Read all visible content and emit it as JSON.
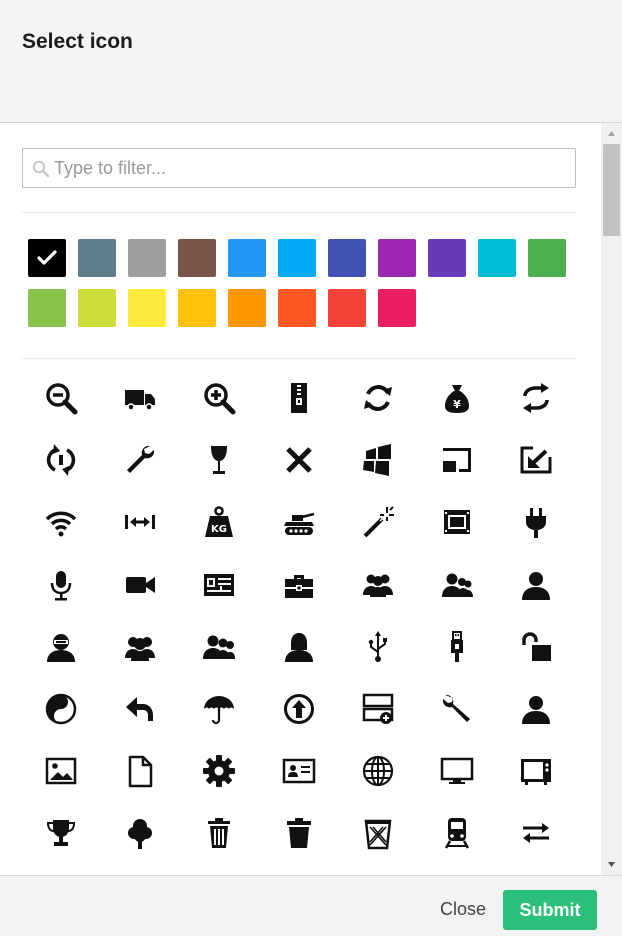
{
  "dialog": {
    "title": "Select icon"
  },
  "filter": {
    "placeholder": "Type to filter...",
    "value": ""
  },
  "colors": {
    "selected_index": 0,
    "swatches": [
      "#000000",
      "#607d8b",
      "#9e9e9e",
      "#795548",
      "#2196f3",
      "#03a9f4",
      "#3f51b5",
      "#9c27b0",
      "#673ab7",
      "#00bcd4",
      "#4caf50",
      "#8bc34a",
      "#cddc39",
      "#ffeb3b",
      "#ffc107",
      "#ff9800",
      "#ff5722",
      "#f44336",
      "#e91e63"
    ]
  },
  "icons": [
    "zoom-out-icon",
    "truck-icon",
    "zoom-in-icon",
    "zip-file-icon",
    "refresh-icon",
    "money-bag-icon",
    "sync-icon",
    "rotate-icon",
    "wrench-icon",
    "wine-glass-icon",
    "close-x-icon",
    "windows-icon",
    "cast-icon",
    "import-icon",
    "wifi-icon",
    "width-icon",
    "weight-icon",
    "tank-icon",
    "magic-wand-icon",
    "video-file-icon",
    "plug-icon",
    "microphone-icon",
    "video-camera-icon",
    "vcard-icon",
    "toolbox-icon",
    "users-icon",
    "user-group-icon",
    "user-icon",
    "user-ninja-icon",
    "users-three-icon",
    "user-group-alt-icon",
    "user-female-icon",
    "usb-icon",
    "usb-stick-icon",
    "unlock-icon",
    "yin-yang-icon",
    "undo-icon",
    "umbrella-icon",
    "upload-circle-icon",
    "server-add-icon",
    "wrench-alt-icon",
    "user-alt-icon",
    "image-icon",
    "document-icon",
    "gear-icon",
    "id-card-icon",
    "globe-icon",
    "monitor-icon",
    "tv-icon",
    "trophy-icon",
    "tree-icon",
    "trash-icon",
    "trash-bin-icon",
    "recycle-bin-icon",
    "train-icon",
    "transfer-icon"
  ],
  "footer": {
    "close_label": "Close",
    "submit_label": "Submit"
  },
  "accent": {
    "submit": "#2bbf7a",
    "header_bg": "#f3f3f5"
  }
}
